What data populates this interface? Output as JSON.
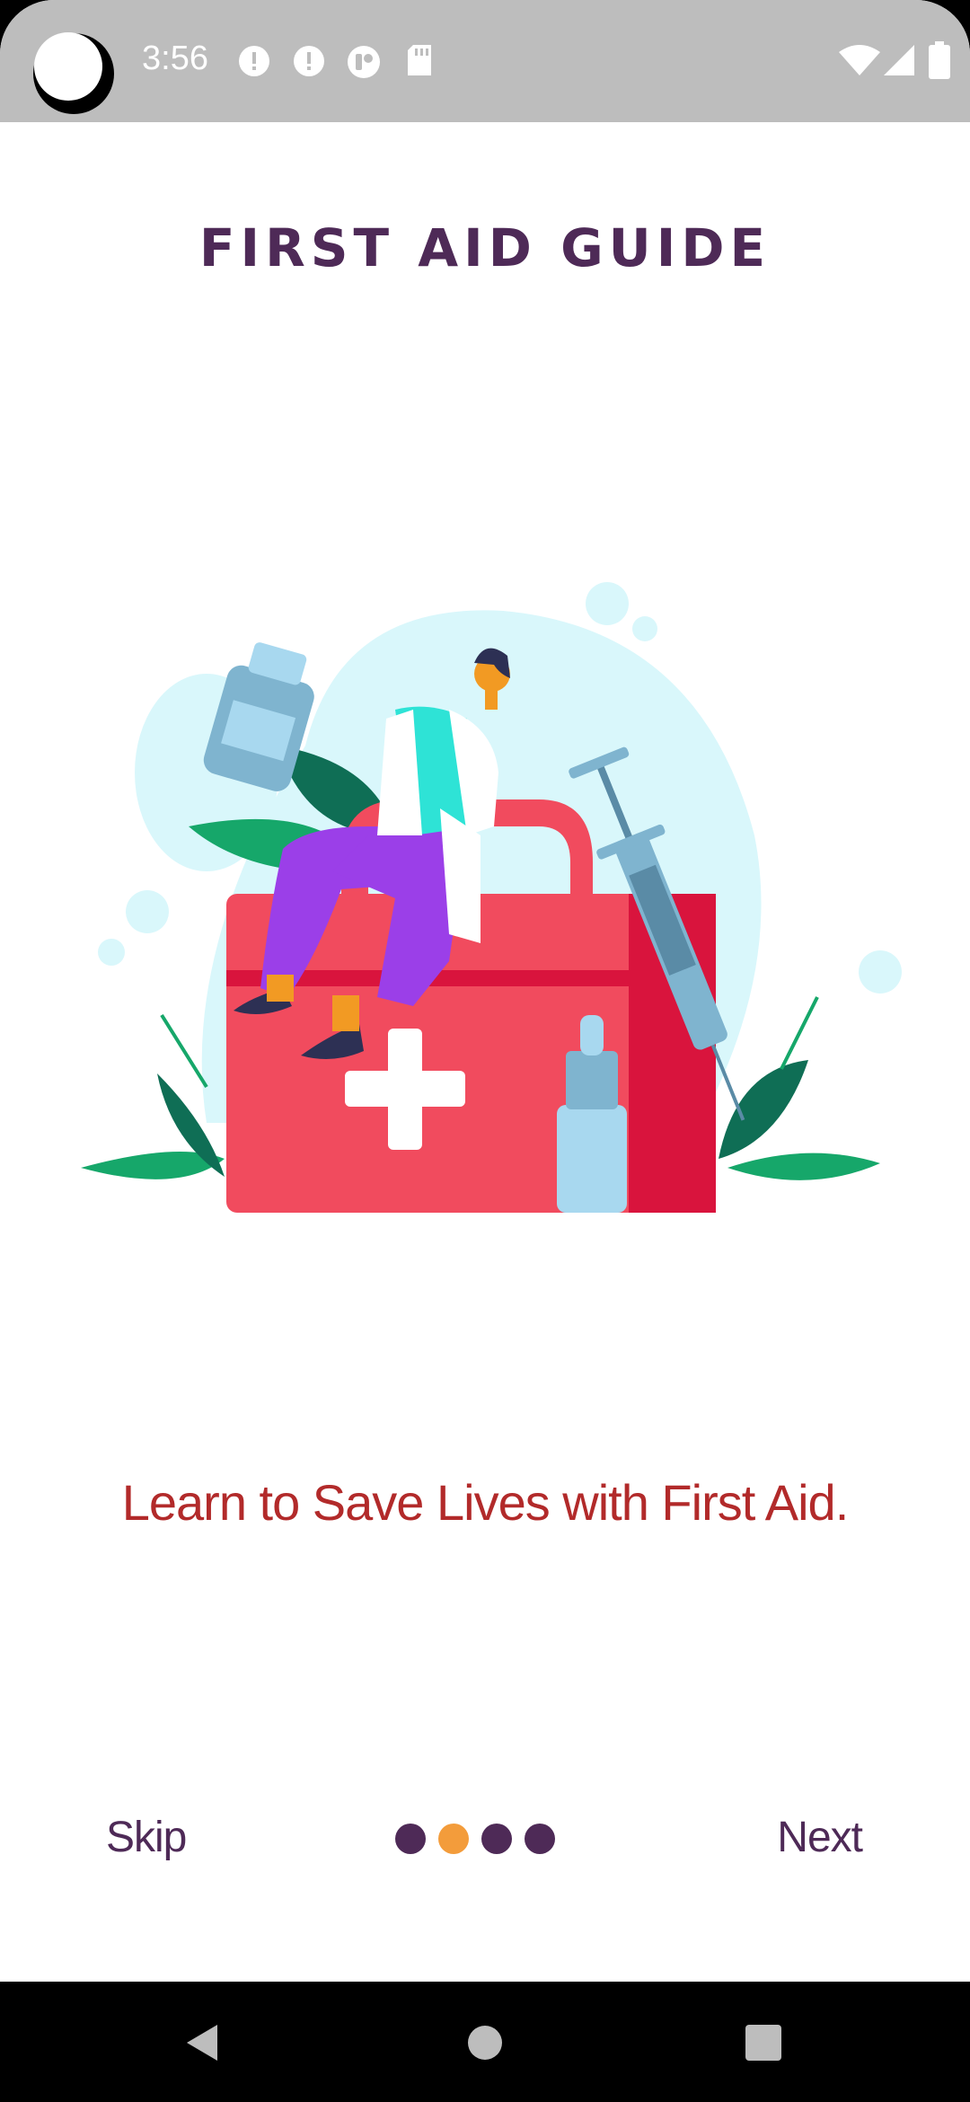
{
  "status_bar": {
    "time": "3:56",
    "icons": [
      "alert-icon",
      "alert-icon",
      "podcast-icon",
      "sd-card-icon",
      "wifi-icon",
      "signal-icon",
      "battery-icon"
    ]
  },
  "app": {
    "title": "FIRST AID GUIDE",
    "tagline": "Learn to Save Lives with First Aid."
  },
  "onboarding": {
    "skip_label": "Skip",
    "next_label": "Next",
    "page_count": 4,
    "current_page": 2,
    "active_dot_color": "#f39c3b",
    "dot_color": "#4e2a57"
  },
  "nav_bar": {
    "icons": [
      "back-icon",
      "home-icon",
      "recents-icon"
    ]
  },
  "colors": {
    "title": "#4e2a57",
    "tagline": "#b22a2a",
    "kit_red": "#f14b5e"
  }
}
